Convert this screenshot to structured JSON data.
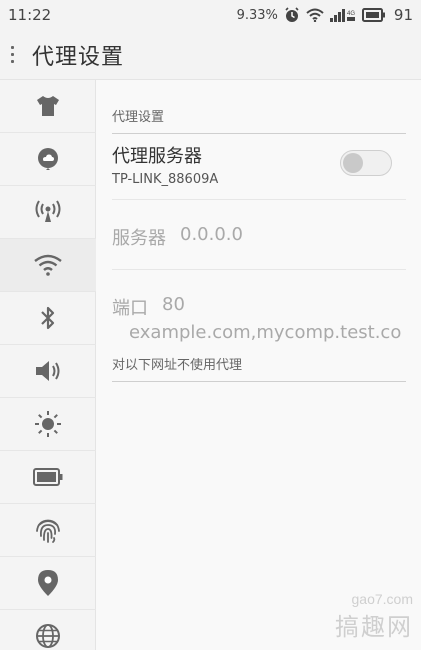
{
  "status_bar": {
    "time": "11:22",
    "speed": "9.33%",
    "network": "4G",
    "battery": "91"
  },
  "app_bar": {
    "title": "代理设置"
  },
  "sidebar": {
    "items": [
      {
        "icon": "shirt-icon"
      },
      {
        "icon": "cloud-icon"
      },
      {
        "icon": "hotspot-icon"
      },
      {
        "icon": "wifi-icon",
        "active": true
      },
      {
        "icon": "bluetooth-icon"
      },
      {
        "icon": "speaker-icon"
      },
      {
        "icon": "brightness-icon"
      },
      {
        "icon": "battery-icon"
      },
      {
        "icon": "fingerprint-icon"
      },
      {
        "icon": "location-icon"
      },
      {
        "icon": "globe-icon"
      }
    ]
  },
  "proxy": {
    "section_label": "代理设置",
    "server_title": "代理服务器",
    "network_name": "TP-LINK_88609A",
    "server_label": "服务器",
    "server_value": "0.0.0.0",
    "port_label": "端口",
    "port_value": "80",
    "exclusion_section_label": "对以下网址不使用代理",
    "exclusion_value": "example.com,mycomp.test.co"
  },
  "watermark": {
    "url": "gao7.com",
    "brand": "搞趣网"
  },
  "colors": {
    "background": "#f8f8f8",
    "text": "#333333",
    "muted": "#a9a9a9",
    "toggle_off": "#c9c9c9"
  }
}
